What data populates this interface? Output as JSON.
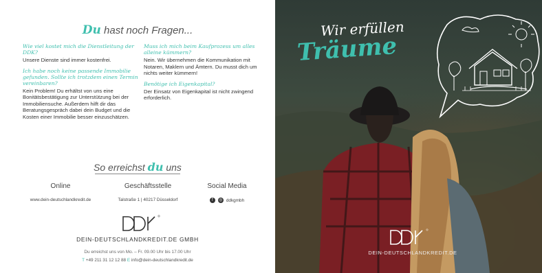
{
  "left": {
    "headline": {
      "accent": "Du",
      "rest": " hast noch Fragen..."
    },
    "faq": [
      {
        "question": "Wie viel kostet mich die Dienstleitung der DDK?",
        "answer": "Unsere Dienste sind immer kostenfrei."
      },
      {
        "question": "Ich habe noch keine passende Immobilie gefunden. Sollte ich trotzdem einen Termin vereinbaren?",
        "answer": "Kein Problem! Du erhältst von uns eine Bonitätsbestätigung zur Unterstützung bei der Immobiliensuche. Außerdem hilft dir das Beratungsgespräch dabei dein Budget und die Kosten einer Immobilie besser einzuschätzen."
      },
      {
        "question": "Muss ich mich beim Kaufprozess um alles alleine kümmern?",
        "answer": "Nein. Wir übernehmen die Kommunikation mit Notaren, Maklern und Ämtern. Du musst dich um nichts weiter kümmern!"
      },
      {
        "question": "Benötige ich Eigenkapital?",
        "answer": "Der Einsatz von Eigenkapital ist nicht zwingend erforderlich."
      }
    ],
    "reach": {
      "before": "So erreichst ",
      "accent": "du",
      "after": " uns"
    },
    "contact": {
      "online_label": "Online",
      "online_value": "www.dein-deutschlandkredit.de",
      "office_label": "Geschäftsstelle",
      "office_value": "Talstraße 1 | 40217 Düsseldorf",
      "social_label": "Social Media",
      "social_value": "ddkgmbh"
    },
    "company": "DEIN-DEUTSCHLANDKREDIT.DE GMBH",
    "hours": "Du erreichst uns von Mo. – Fr. 09.00 Uhr bis 17.00 Uhr",
    "phone_prefix": "T",
    "phone": " +49 211 31 12 12 88 ",
    "email_prefix": "E",
    "email": " info@dein-deutschlandkredit.de"
  },
  "right": {
    "tagline_1": "Wir erfüllen",
    "tagline_2": "Träume",
    "company": "DEIN-DEUTSCHLANDKREDIT.DE"
  },
  "colors": {
    "accent": "#3fbfae",
    "text": "#333333",
    "photo_dark": "#3d4a3f"
  }
}
